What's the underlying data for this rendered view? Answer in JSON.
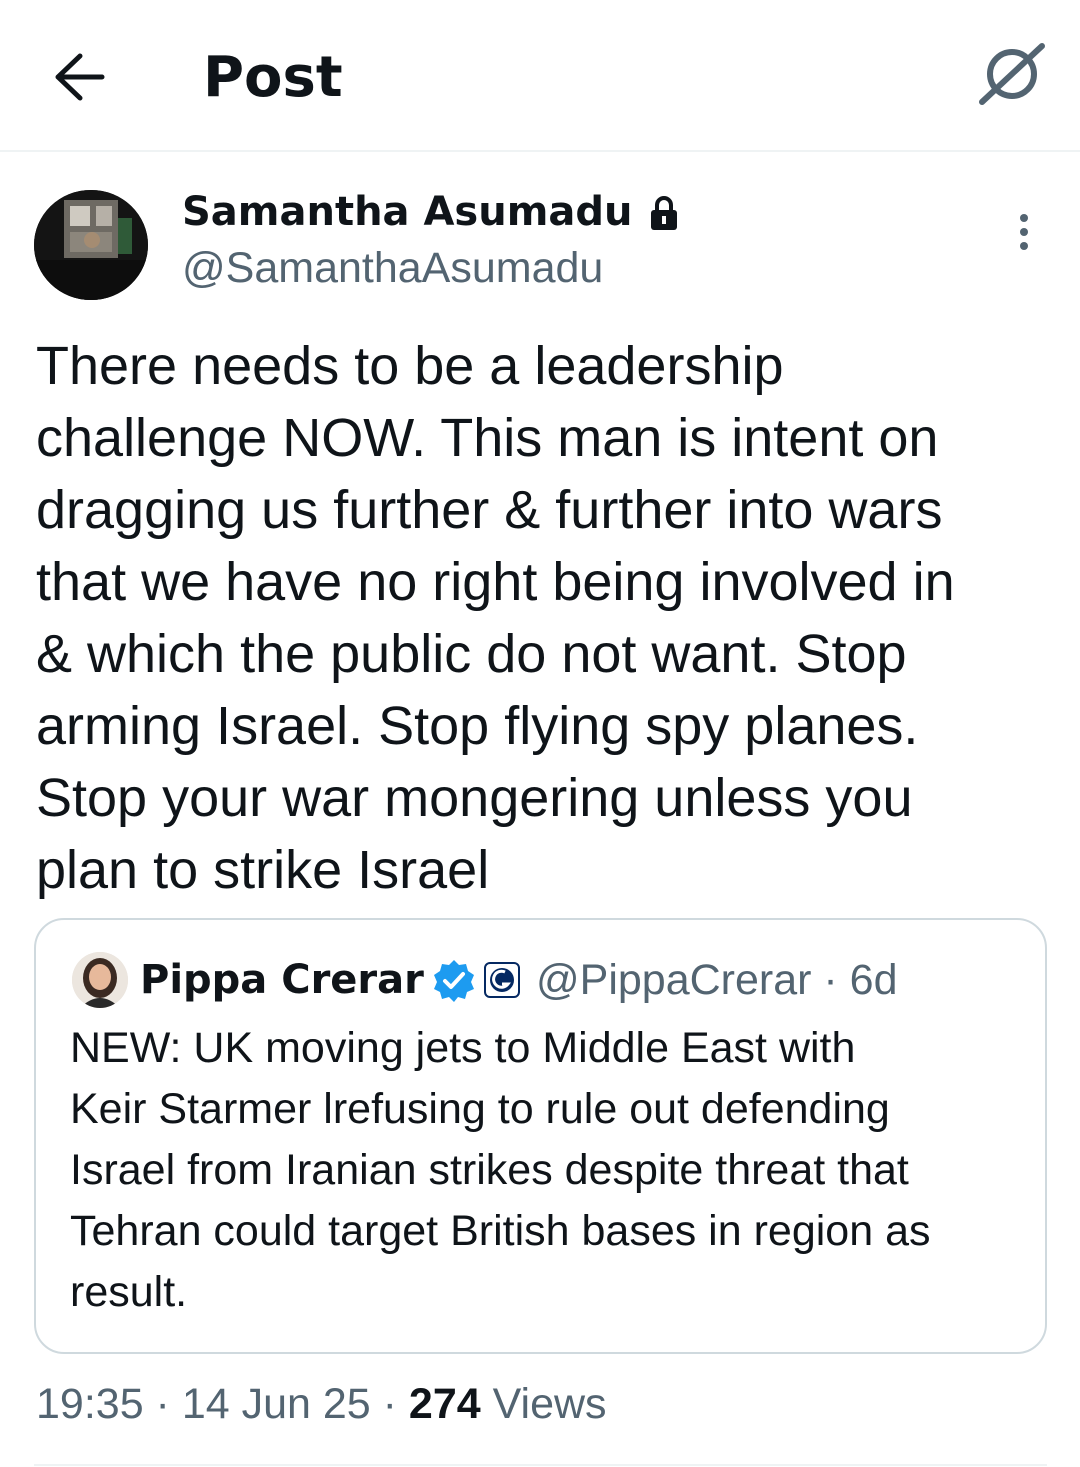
{
  "header": {
    "title": "Post",
    "back_icon": "arrow-left-icon",
    "grok_icon": "grok-icon"
  },
  "post": {
    "author_name": "Samantha Asumadu",
    "author_handle": "@SamanthaAsumadu",
    "protected_icon": "lock-icon",
    "more_icon": "more-vertical-icon",
    "text_lines": [
      "There needs to be a leadership",
      "challenge NOW. This man is intent on",
      "dragging us further & further into wars",
      "that we have no right being involved in",
      "& which the public do not want. Stop",
      "arming Israel. Stop flying spy planes.",
      "Stop your war mongering unless you",
      "plan to strike Israel"
    ],
    "timestamp": "19:35 · 14 Jun 25 · ",
    "views_count": "274",
    "views_label": " Views"
  },
  "quote": {
    "author_name": "Pippa Crerar",
    "verified_icon": "verified-badge-icon",
    "org_icon": "guardian-logo-icon",
    "author_handle": "@PippaCrerar",
    "age": " · 6d",
    "text_lines": [
      "NEW: UK moving jets to Middle East with",
      "Keir Starmer lrefusing to rule out defending",
      "Israel from Iranian strikes despite threat that",
      "Tehran could target British bases in region as",
      "result."
    ]
  },
  "colors": {
    "text": "#0f1419",
    "secondary": "#536471",
    "border": "#cfd9de",
    "verified": "#1d9bf0"
  }
}
